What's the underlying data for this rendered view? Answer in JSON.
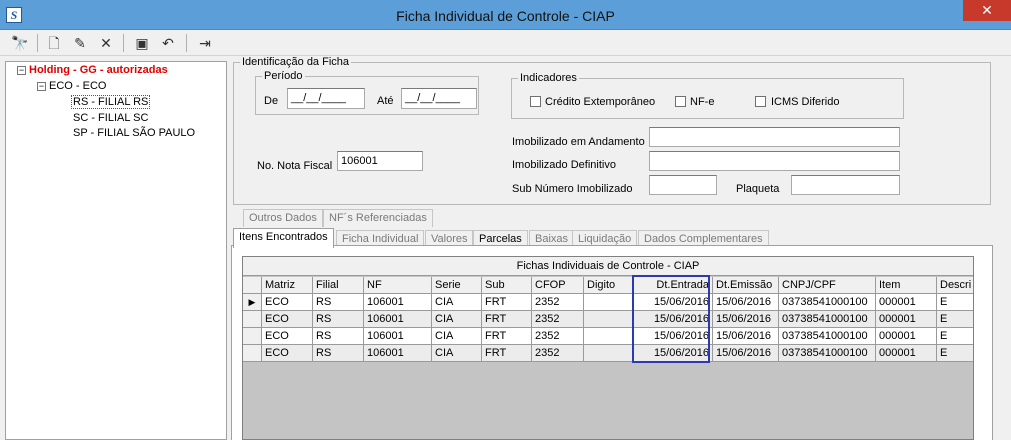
{
  "window": {
    "title": "Ficha Individual de Controle - CIAP",
    "app_icon_glyph": "S",
    "close_glyph": "✕"
  },
  "toolbar": {
    "buttons": [
      {
        "name": "search-icon",
        "glyph": "🔭"
      },
      {
        "name": "new-document-icon",
        "glyph": "🗋"
      },
      {
        "name": "edit-icon",
        "glyph": "✎"
      },
      {
        "name": "delete-icon",
        "glyph": "✕"
      },
      {
        "name": "save-icon",
        "glyph": "▣"
      },
      {
        "name": "undo-icon",
        "glyph": "↶"
      },
      {
        "name": "exit-icon",
        "glyph": "⇥"
      }
    ]
  },
  "tree": {
    "expander_open": "−",
    "root": "Holding -  GG -  autorizadas",
    "company": "ECO - ECO",
    "branches": [
      "RS - FILIAL RS",
      "SC - FILIAL SC",
      "SP - FILIAL SÃO PAULO"
    ]
  },
  "identificacao": {
    "legend": "Identificação da Ficha",
    "periodo": {
      "legend": "Período",
      "de_label": "De",
      "ate_label": "Até",
      "de_value": "__/__/____",
      "ate_value": "__/__/____"
    },
    "indicadores": {
      "legend": "Indicadores",
      "credito": "Crédito Extemporâneo",
      "nfe": "NF-e",
      "icms": "ICMS Diferido"
    },
    "nota_fiscal_label": "No. Nota Fiscal",
    "nota_fiscal_value": "106001",
    "imobilizado_andamento_label": "Imobilizado em Andamento",
    "imobilizado_definitivo_label": "Imobilizado Definitivo",
    "sub_numero_label": "Sub Número Imobilizado",
    "plaqueta_label": "Plaqueta"
  },
  "tabs_row1": [
    "Outros Dados",
    "NF´s Referenciadas"
  ],
  "tabs_row2": [
    "Itens Encontrados",
    "Ficha Individual",
    "Valores",
    "Parcelas",
    "Baixas",
    "Liquidação",
    "Dados Complementares"
  ],
  "grid": {
    "caption": "Fichas Individuais de Controle - CIAP",
    "current_row_marker": "▶",
    "columns": [
      "Matriz",
      "Filial",
      "NF",
      "Serie",
      "Sub",
      "CFOP",
      "Digito",
      "Dt.Entrada",
      "Dt.Emissão",
      "CNPJ/CPF",
      "Item",
      "Descri"
    ],
    "rows": [
      [
        "ECO",
        "RS",
        "106001",
        "CIA",
        "FRT",
        "2352",
        "",
        "15/06/2016",
        "15/06/2016",
        "03738541000100",
        "000001",
        "E"
      ],
      [
        "ECO",
        "RS",
        "106001",
        "CIA",
        "FRT",
        "2352",
        "",
        "15/06/2016",
        "15/06/2016",
        "03738541000100",
        "000001",
        "E"
      ],
      [
        "ECO",
        "RS",
        "106001",
        "CIA",
        "FRT",
        "2352",
        "",
        "15/06/2016",
        "15/06/2016",
        "03738541000100",
        "000001",
        "E"
      ],
      [
        "ECO",
        "RS",
        "106001",
        "CIA",
        "FRT",
        "2352",
        "",
        "15/06/2016",
        "15/06/2016",
        "03738541000100",
        "000001",
        "E"
      ]
    ],
    "highlight_color": "#2c39b0"
  }
}
